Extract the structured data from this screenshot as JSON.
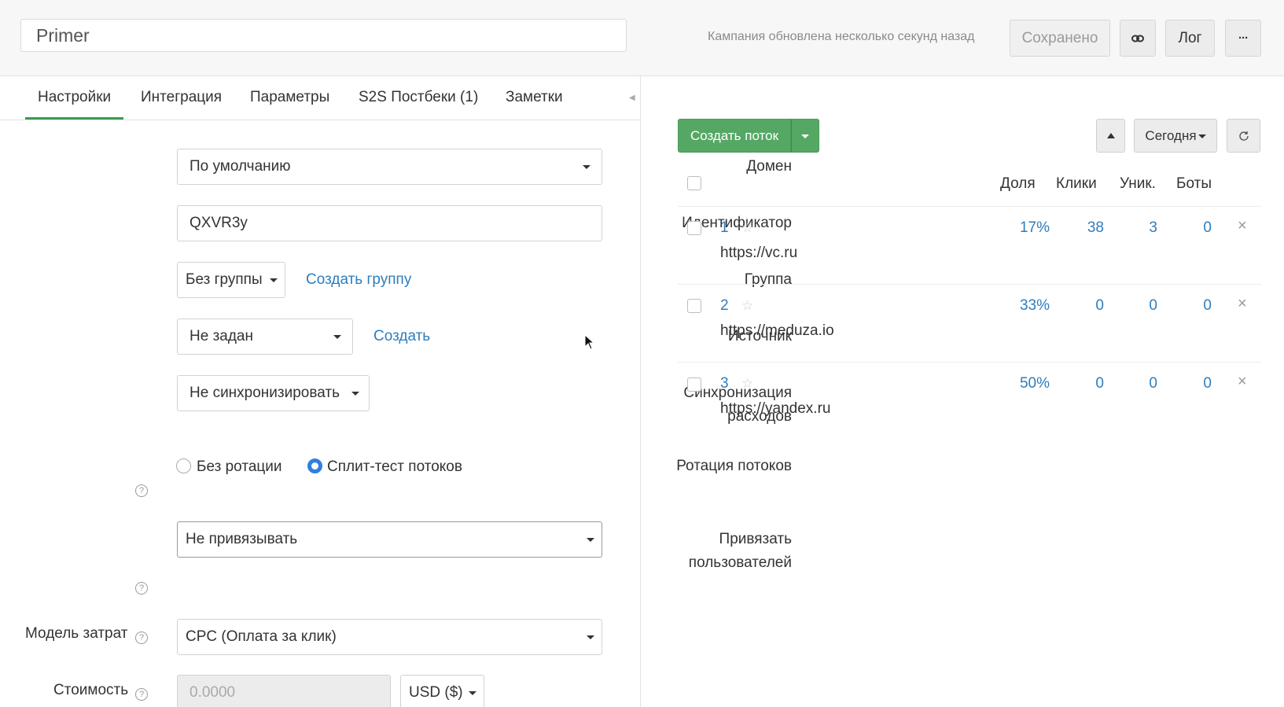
{
  "header": {
    "campaign_name": "Primer",
    "status": "Кампания обновлена несколько секунд назад",
    "saved_label": "Сохранено",
    "link_icon": "link-icon",
    "log_label": "Лог",
    "more_label": "···"
  },
  "tabs": [
    {
      "label": "Настройки",
      "active": true
    },
    {
      "label": "Интеграция"
    },
    {
      "label": "Параметры"
    },
    {
      "label": "S2S Постбеки (1)"
    },
    {
      "label": "Заметки"
    }
  ],
  "form": {
    "domain": {
      "label": "Домен",
      "value": "По умолчанию"
    },
    "identifier": {
      "label": "Идентификатор",
      "value": "QXVR3y"
    },
    "group": {
      "label": "Группа",
      "value": "Без группы",
      "create_link": "Создать группу"
    },
    "source": {
      "label": "Источник",
      "value": "Не задан",
      "create_link": "Создать"
    },
    "sync": {
      "label_line1": "Синхронизация",
      "label_line2": "расходов",
      "value": "Не синхронизировать"
    },
    "rotation": {
      "label": "Ротация потоков",
      "option1": "Без ротации",
      "option2": "Сплит-тест потоков",
      "selected": "Сплит-тест потоков"
    },
    "bind_users": {
      "label_line1": "Привязать",
      "label_line2": "пользователей",
      "value": "Не привязывать"
    },
    "cost_model": {
      "label": "Модель затрат",
      "value": "CPC (Оплата за клик)"
    },
    "cost": {
      "label": "Стоимость",
      "placeholder": "0.0000",
      "currency": "USD ($)"
    },
    "help_glyph": "?"
  },
  "streams_panel": {
    "create_label": "Создать поток",
    "period_label": "Сегодня",
    "sort_icon": "triangle-up-icon",
    "refresh_icon": "refresh-icon",
    "columns": [
      "Доля",
      "Клики",
      "Уник.",
      "Боты"
    ],
    "rows": [
      {
        "num": "1",
        "url": "https://vc.ru",
        "share": "17%",
        "clicks": "38",
        "unique": "3",
        "bots": "0"
      },
      {
        "num": "2",
        "url": "https://meduza.io",
        "share": "33%",
        "clicks": "0",
        "unique": "0",
        "bots": "0"
      },
      {
        "num": "3",
        "url": "https://yandex.ru",
        "share": "50%",
        "clicks": "0",
        "unique": "0",
        "bots": "0"
      }
    ]
  },
  "colors": {
    "accent_green": "#55a864",
    "link_blue": "#2e7dbd",
    "radio_blue": "#2f7fe5"
  }
}
